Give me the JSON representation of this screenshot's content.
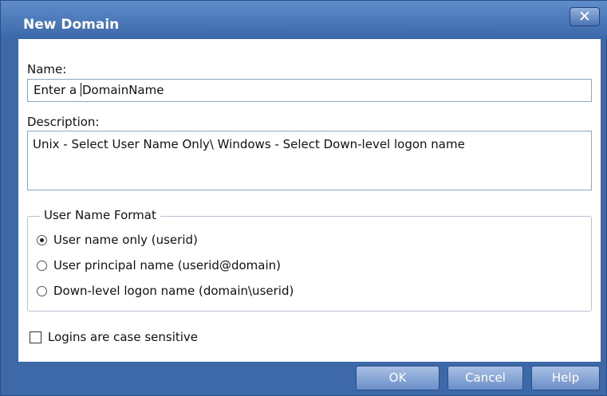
{
  "dialog": {
    "title": "New Domain",
    "close_label": "✕"
  },
  "name": {
    "label": "Name:",
    "value_before_caret": "Enter a ",
    "value_after_caret": "DomainName"
  },
  "description": {
    "label": "Description:",
    "value": "Unix - Select User Name Only\\ Windows - Select Down-level logon name"
  },
  "user_name_format": {
    "legend": "User Name Format",
    "options": [
      {
        "label": "User name only (userid)",
        "checked": true
      },
      {
        "label": "User principal name (userid@domain)",
        "checked": false
      },
      {
        "label": "Down-level logon name (domain\\userid)",
        "checked": false
      }
    ]
  },
  "case_sensitive": {
    "label": "Logins are case sensitive",
    "checked": false
  },
  "buttons": {
    "ok": "OK",
    "cancel": "Cancel",
    "help": "Help"
  },
  "colors": {
    "frame": "#3e69a8",
    "content_background": "#ffffff",
    "button": "#6a8fc9"
  }
}
